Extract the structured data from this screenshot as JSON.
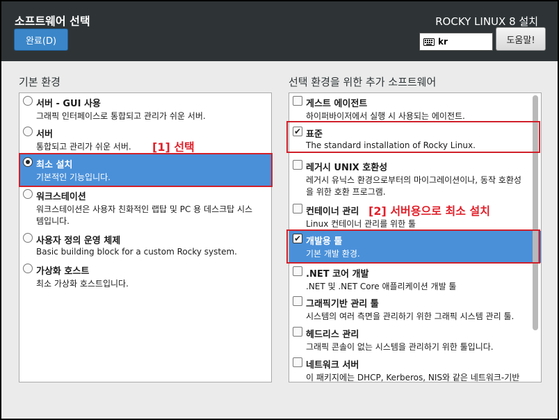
{
  "header": {
    "title": "소프트웨어 선택",
    "done_label": "완료(D)",
    "product": "ROCKY LINUX 8 설치",
    "keyboard_layout": "kr",
    "help_label": "도움말!"
  },
  "left": {
    "heading": "기본 환경",
    "items": [
      {
        "title": "서버 - GUI 사용",
        "desc": "그래픽 인터페이스로 통합되고 관리가 쉬운 서버.",
        "selected": false
      },
      {
        "title": "서버",
        "desc": "통합되고 관리가 쉬운 서버.",
        "selected": false
      },
      {
        "title": "최소 설치",
        "desc": "기본적인 기능입니다.",
        "selected": true
      },
      {
        "title": "워크스테이션",
        "desc": "워크스테이션은 사용자 친화적인 랩탑 및 PC 용 데스크탑 시스",
        "desc2": "템입니다.",
        "selected": false
      },
      {
        "title": "사용자 정의 운영 체제",
        "desc": "Basic building block for a custom Rocky system.",
        "selected": false
      },
      {
        "title": "가상화 호스트",
        "desc": "최소 가상화 호스트입니다.",
        "selected": false
      }
    ]
  },
  "right": {
    "heading": "선택 환경을 위한 추가 소프트웨어",
    "items": [
      {
        "title": "게스트 에이전트",
        "desc": "하이퍼바이저에서 실행 시 사용되는 에이전트.",
        "checked": false
      },
      {
        "title": "표준",
        "desc": "The standard installation of Rocky Linux.",
        "checked": true
      },
      {
        "title": "레거시 UNIX 호환성",
        "desc": "레거시 유닉스 환경으로부터의 마이그레이션이나, 동작 호환성",
        "desc2": "을 위한 호환 프로그램.",
        "checked": false
      },
      {
        "title": "컨테이너 관리",
        "desc": "Linux 컨테이너 관리를 위한 툴",
        "checked": false
      },
      {
        "title": "개발용 툴",
        "desc": "기본 개발 환경.",
        "checked": true
      },
      {
        "title": ".NET 코어 개발",
        "desc": ".NET 및 .NET Core 애플리케이션 개발 툴",
        "checked": false
      },
      {
        "title": "그래픽기반 관리 툴",
        "desc": "시스템의 여러 측면을 관리하기 위한 그래픽 시스템 관리 툴.",
        "checked": false
      },
      {
        "title": "헤드리스 관리",
        "desc": "그래픽 콘솔이 없는 시스템을 관리하기 위한 툴입니다.",
        "checked": false
      },
      {
        "title": "네트워크 서버",
        "desc": "이 패키지에는 DHCP, Kerberos, NIS와 같은 네트워크-기반",
        "checked": false
      }
    ]
  },
  "annotations": {
    "step1": "[1] 선택",
    "step2": "[2] 서버용으로 최소 설치",
    "color": "#e0202a"
  },
  "colors": {
    "topbar": "#2e3436",
    "selection": "#4a90d9",
    "done_button": "#3b86c8"
  }
}
